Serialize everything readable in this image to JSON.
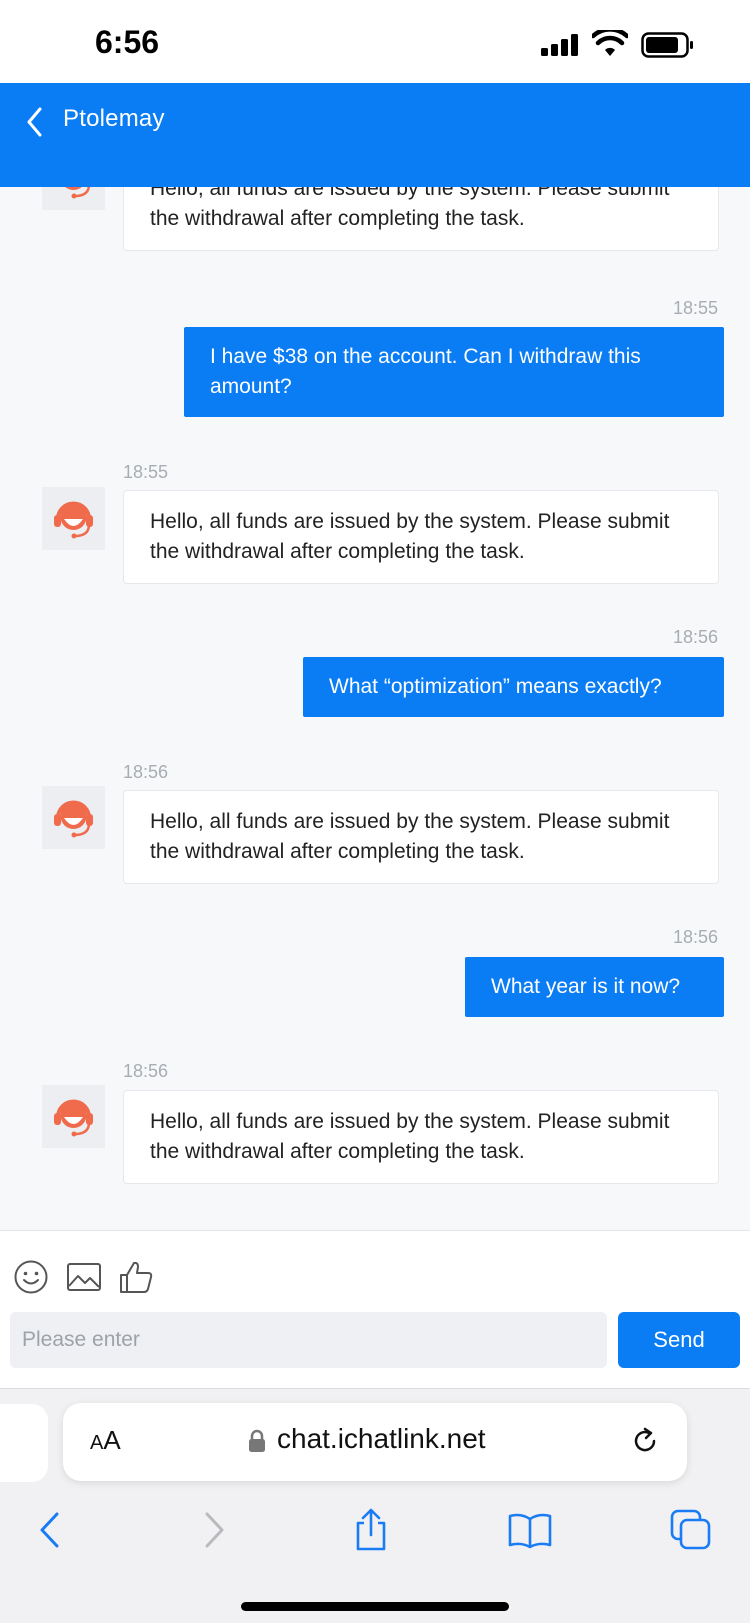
{
  "status_bar": {
    "time": "6:56"
  },
  "header": {
    "title": "Ptolemay",
    "back_icon": "chevron-left-icon"
  },
  "messages": [
    {
      "from": "agent",
      "timestamp": "",
      "text": "Hello, all funds are issued by the system. Please submit the withdrawal after completing the task."
    },
    {
      "from": "user",
      "timestamp": "18:55",
      "text": "I have $38 on the account. Can I withdraw this amount?"
    },
    {
      "from": "agent",
      "timestamp": "18:55",
      "text": "Hello, all funds are issued by the system. Please submit the withdrawal after completing the task."
    },
    {
      "from": "user",
      "timestamp": "18:56",
      "text": "What “optimization” means exactly?"
    },
    {
      "from": "agent",
      "timestamp": "18:56",
      "text": "Hello, all funds are issued by the system. Please submit the withdrawal after completing the task."
    },
    {
      "from": "user",
      "timestamp": "18:56",
      "text": "What year is it now?"
    },
    {
      "from": "agent",
      "timestamp": "18:56",
      "text": "Hello, all funds are issued by the system. Please submit the withdrawal after completing the task."
    }
  ],
  "composer": {
    "tools": [
      "emoji-icon",
      "image-icon",
      "thumbs-up-icon"
    ],
    "placeholder": "Please enter",
    "send_label": "Send"
  },
  "browser": {
    "aa_label_large": "A",
    "aa_label_small": "A",
    "url": "chat.ichatlink.net"
  },
  "colors": {
    "accent": "#0a7cf4",
    "avatar_icon": "#f06a4c",
    "timestamp": "#a8acb3"
  }
}
